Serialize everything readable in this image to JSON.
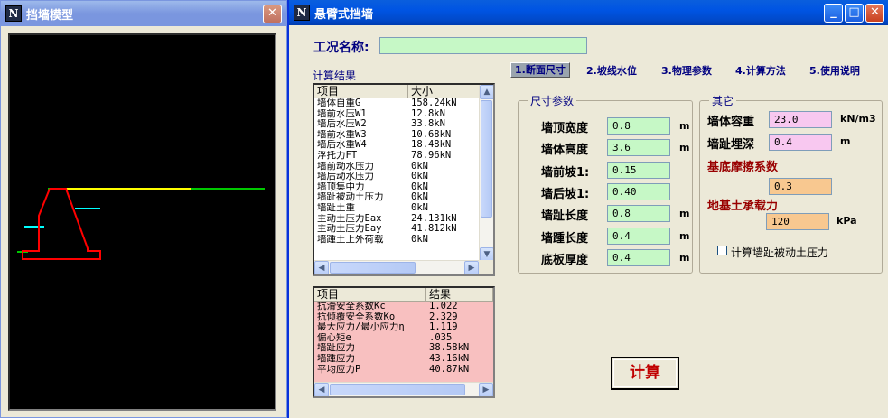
{
  "left_window": {
    "title": "挡墙模型",
    "close_glyph": "✕"
  },
  "main_window": {
    "title": "悬臂式挡墙",
    "minimize_glyph": "_",
    "maximize_glyph": "□",
    "close_glyph": "✕"
  },
  "case_name": {
    "label": "工况名称:",
    "value": ""
  },
  "results_caption": "计算结果",
  "tabs": [
    {
      "label": "1.断面尺寸",
      "active": true
    },
    {
      "label": "2.坡线水位",
      "active": false
    },
    {
      "label": "3.物理参数",
      "active": false
    },
    {
      "label": "4.计算方法",
      "active": false
    },
    {
      "label": "5.使用说明",
      "active": false
    }
  ],
  "results_table": {
    "headers": [
      "项目",
      "大小"
    ],
    "rows": [
      [
        "墙体自重G",
        "158.24kN"
      ],
      [
        "墙前水压W1",
        "12.8kN"
      ],
      [
        "墙后水压W2",
        "33.8kN"
      ],
      [
        "墙前水重W3",
        "10.68kN"
      ],
      [
        "墙后水重W4",
        "18.48kN"
      ],
      [
        "浮托力FT",
        "78.96kN"
      ],
      [
        "墙前动水压力",
        "0kN"
      ],
      [
        "墙后动水压力",
        "0kN"
      ],
      [
        "墙顶集中力",
        "0kN"
      ],
      [
        "墙趾被动土压力",
        "0kN"
      ],
      [
        "墙趾土重",
        "0kN"
      ],
      [
        "主动土压力Eax",
        "24.131kN"
      ],
      [
        "主动土压力Eay",
        "41.812kN"
      ],
      [
        "墙踵土上外荷载",
        "0kN"
      ]
    ]
  },
  "safety_table": {
    "headers": [
      "项目",
      "结果"
    ],
    "rows": [
      [
        "抗滑安全系数Kc",
        "1.022"
      ],
      [
        "抗倾覆安全系数Ko",
        "2.329"
      ],
      [
        "最大应力/最小应力η",
        "1.119"
      ],
      [
        "偏心矩e",
        ".035"
      ],
      [
        "墙趾应力",
        "38.58kN"
      ],
      [
        "墙踵应力",
        "43.16kN"
      ],
      [
        "平均应力P",
        "40.87kN"
      ]
    ]
  },
  "size_params": {
    "legend": "尺寸参数",
    "fields": [
      {
        "label": "墙顶宽度",
        "value": "0.8",
        "unit": "m"
      },
      {
        "label": "墙体高度",
        "value": "3.6",
        "unit": "m"
      },
      {
        "label": "墙前坡1:",
        "value": "0.15",
        "unit": ""
      },
      {
        "label": "墙后坡1:",
        "value": "0.40",
        "unit": ""
      },
      {
        "label": "墙趾长度",
        "value": "0.8",
        "unit": "m"
      },
      {
        "label": "墙踵长度",
        "value": "0.4",
        "unit": "m"
      },
      {
        "label": "底板厚度",
        "value": "0.4",
        "unit": "m"
      }
    ]
  },
  "other_params": {
    "legend": "其它",
    "unit_weight": {
      "label": "墙体容重",
      "value": "23.0",
      "unit": "kN/m3"
    },
    "toe_depth": {
      "label": "墙趾埋深",
      "value": "0.4",
      "unit": "m"
    },
    "friction": {
      "label": "基底摩擦系数",
      "value": "0.3"
    },
    "bearing": {
      "label": "地基土承载力",
      "value": "120",
      "unit": "kPa"
    },
    "passive_checkbox": {
      "label": "计算墙趾被动土压力",
      "checked": false
    }
  },
  "calc_button": "计算",
  "colors": {
    "wall_outline": "#ff0000",
    "ground_line": "#00c800",
    "water_line": "#ffff00",
    "water_marks": "#00ffff",
    "canvas_bg": "#000000"
  },
  "scroll_glyphs": {
    "up": "▲",
    "down": "▼",
    "left": "◀",
    "right": "▶"
  }
}
